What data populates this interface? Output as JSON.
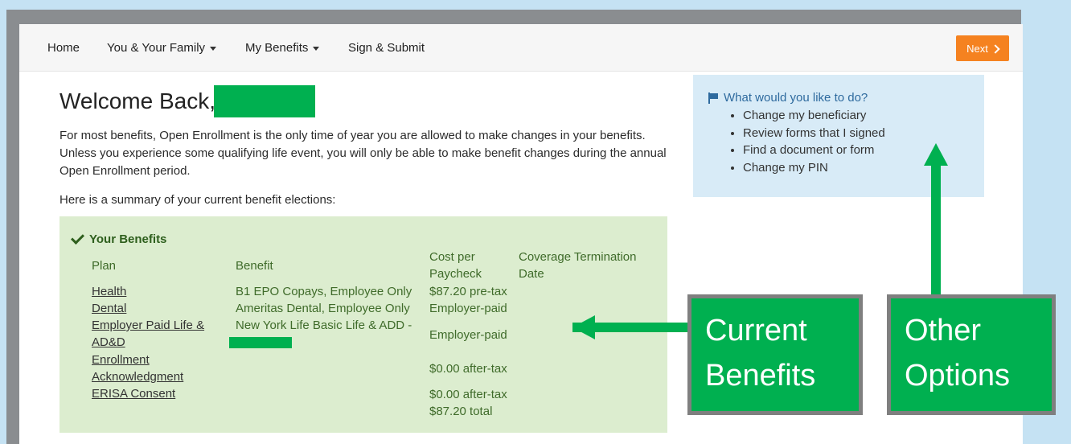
{
  "nav": {
    "home": "Home",
    "family": "You & Your Family",
    "benefits": "My Benefits",
    "submit": "Sign & Submit",
    "next": "Next"
  },
  "welcome": {
    "title": "Welcome Back,",
    "intro": "For most benefits, Open Enrollment is the only time of year you are allowed to make changes in your benefits. Unless you experience some qualifying life event, you will only be able to make benefit changes during the annual Open Enrollment period.",
    "summary": "Here is a summary of your current benefit elections:"
  },
  "benefits": {
    "title": "Your Benefits",
    "headers": {
      "plan": "Plan",
      "benefit": "Benefit",
      "cost_1": "Cost per",
      "cost_2": "Paycheck",
      "term_1": "Coverage Termination",
      "term_2": "Date"
    },
    "plans": [
      "Health",
      "Dental",
      "Employer Paid Life &",
      "AD&D",
      "Enrollment",
      "Acknowledgment",
      "ERISA Consent"
    ],
    "benefit_values": [
      "B1 EPO Copays, Employee Only",
      "Ameritas Dental, Employee Only",
      "New York Life Basic Life & ADD -"
    ],
    "costs": [
      "$87.20 pre-tax",
      "Employer-paid",
      "Employer-paid",
      "$0.00 after-tax",
      "$0.00 after-tax",
      "$87.20 total"
    ]
  },
  "sidebar": {
    "heading": "What would you like to do?",
    "items": [
      "Change my beneficiary",
      "Review forms that I signed",
      "Find a document or form",
      "Change my PIN"
    ]
  },
  "callouts": {
    "current": [
      "Current",
      "Benefits"
    ],
    "other": [
      "Other",
      "Options"
    ]
  },
  "colors": {
    "accent_orange": "#f58220",
    "callout_green": "#00b050",
    "benefits_bg": "#dcedcf",
    "sidebar_bg": "#d8ebf7"
  }
}
